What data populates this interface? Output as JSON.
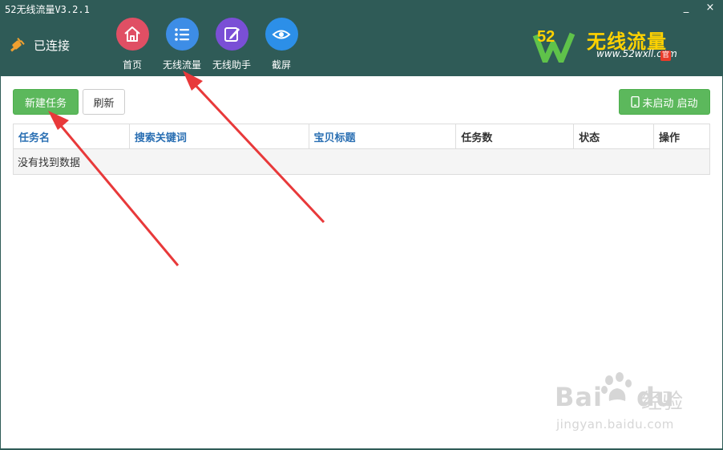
{
  "window": {
    "title": "52无线流量V3.2.1",
    "minimize": "_",
    "close": "×"
  },
  "connection": {
    "label": "已连接",
    "icon": "plug-icon"
  },
  "nav": [
    {
      "label": "首页",
      "icon": "home-icon",
      "color": "#e04f64"
    },
    {
      "label": "无线流量",
      "icon": "list-icon",
      "color": "#3d8de6"
    },
    {
      "label": "无线助手",
      "icon": "edit-icon",
      "color": "#7a4fd6"
    },
    {
      "label": "截屏",
      "icon": "eye-icon",
      "color": "#2c8fe8"
    }
  ],
  "logo": {
    "num": "52",
    "name": "无线流量",
    "url": "www.52wxll.com",
    "badge": "官"
  },
  "toolbar": {
    "new_task": "新建任务",
    "refresh": "刷新",
    "start": "未启动 启动",
    "start_icon": "phone-icon"
  },
  "table": {
    "headers": [
      "任务名",
      "搜索关键词",
      "宝贝标题",
      "任务数",
      "状态",
      "操作"
    ],
    "empty": "没有找到数据"
  },
  "watermark": {
    "brand": "Bai",
    "brand2": "du",
    "cn": "经验",
    "url": "jingyan.baidu.com"
  },
  "colors": {
    "header_bg": "#2f5b57",
    "green": "#5cb85c",
    "link": "#2a6fb3",
    "arrow": "#e8393a"
  }
}
